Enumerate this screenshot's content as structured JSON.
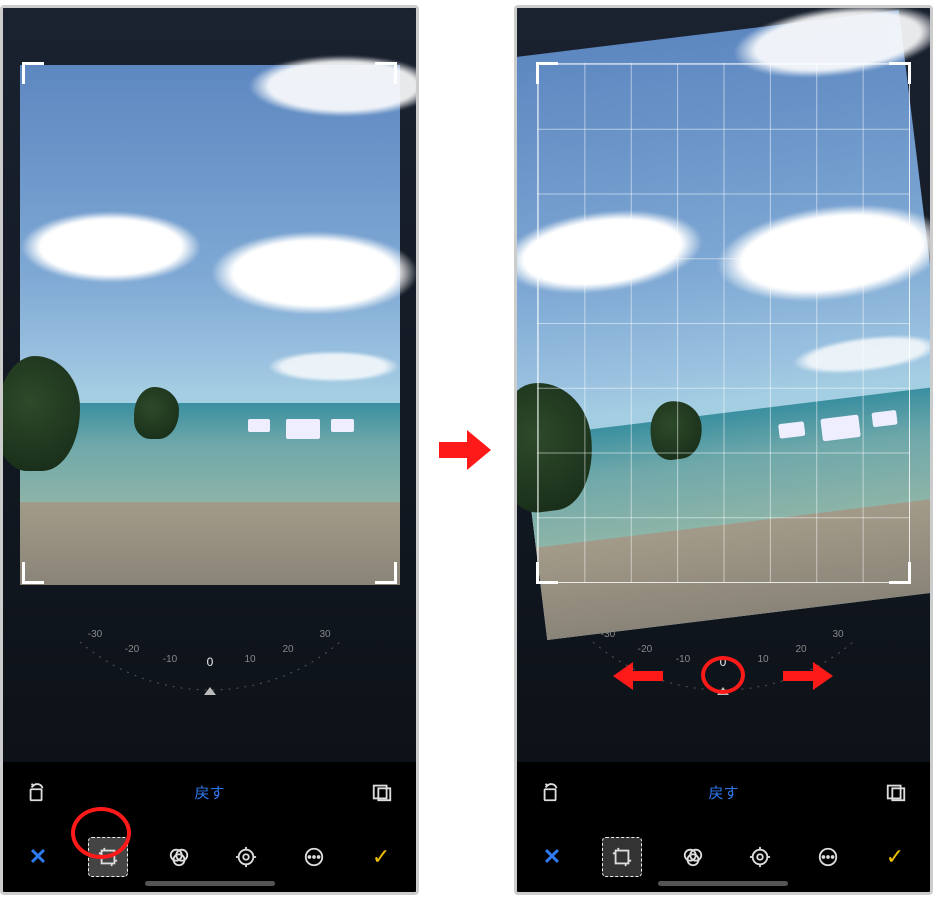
{
  "left_screen": {
    "rotation_dial": {
      "ticks": [
        "-30",
        "-20",
        "-10",
        "0",
        "10",
        "20",
        "30"
      ],
      "value": 0
    },
    "toolbar": {
      "rotate_label": "rotate",
      "reset_label": "戻す",
      "aspect_label": "aspect"
    },
    "modes": {
      "cancel": "✕",
      "crop": "crop",
      "filters": "filters",
      "adjust": "adjust",
      "more": "more",
      "done": "✓"
    },
    "highlight": "crop-tool"
  },
  "right_screen": {
    "rotation_dial": {
      "ticks": [
        "-30",
        "-20",
        "-10",
        "0",
        "10",
        "20",
        "30"
      ],
      "value": 0
    },
    "toolbar": {
      "rotate_label": "rotate",
      "reset_label": "戻す",
      "aspect_label": "aspect"
    },
    "modes": {
      "cancel": "✕",
      "crop": "crop",
      "filters": "filters",
      "adjust": "adjust",
      "more": "more",
      "done": "✓"
    },
    "highlight": "dial-indicator",
    "grid_visible": true,
    "drag_hint": "left-right"
  },
  "transition": "arrow-right",
  "colors": {
    "accent_blue": "#2f7af0",
    "accent_yellow": "#f0c000",
    "annotation_red": "#ff1a1a"
  }
}
